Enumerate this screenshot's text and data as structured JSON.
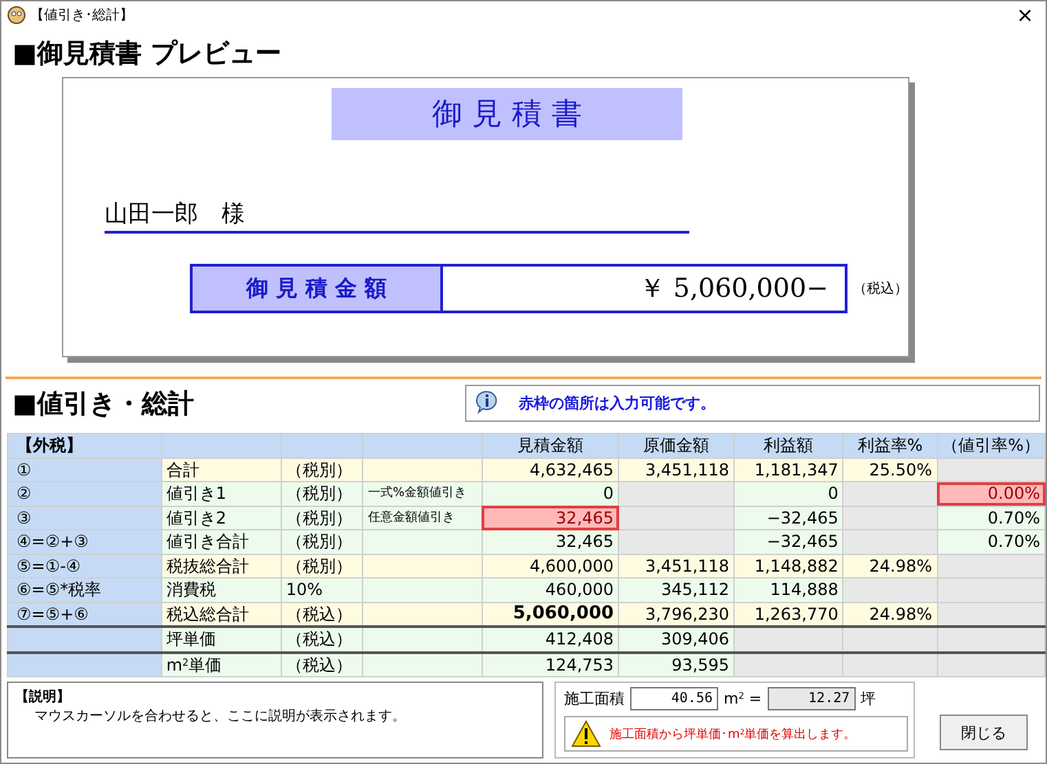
{
  "window": {
    "title": "【値引き･総計】",
    "close": "×"
  },
  "preview": {
    "heading": "■御見積書 プレビュー",
    "doc_title": "御 見 積 書",
    "customer": "山田一郎　様",
    "amount_label": "御 見 積 金 額",
    "amount": "￥ 5,060,000−",
    "tax_note": "（税込）"
  },
  "summary": {
    "heading": "■値引き・総計",
    "info": "赤枠の箇所は入力可能です。"
  },
  "table": {
    "header": [
      {
        "kind": "text",
        "text": "【外税】"
      },
      {
        "kind": "empty"
      },
      {
        "kind": "empty"
      },
      {
        "kind": "empty"
      },
      {
        "kind": "text",
        "text": "見積金額"
      },
      {
        "kind": "text",
        "text": "原価金額"
      },
      {
        "kind": "text",
        "text": "利益額"
      },
      {
        "kind": "text",
        "text": "利益率%"
      },
      {
        "kind": "text",
        "text": "（値引率%）"
      }
    ],
    "rows": [
      {
        "color": "#fffbe1",
        "divider_above": false,
        "cells": [
          {
            "kind": "text",
            "text": "①"
          },
          {
            "kind": "text",
            "text": "合計"
          },
          {
            "kind": "text",
            "text": "（税別）"
          },
          {
            "kind": "empty"
          },
          {
            "kind": "text",
            "text": "4,632,465"
          },
          {
            "kind": "text",
            "text": "3,451,118"
          },
          {
            "kind": "text",
            "text": "1,181,347"
          },
          {
            "kind": "text",
            "text": "25.50%"
          },
          {
            "kind": "gray"
          }
        ]
      },
      {
        "color": "#edfbec",
        "divider_above": false,
        "cells": [
          {
            "kind": "text",
            "text": "②"
          },
          {
            "kind": "text",
            "text": "値引き1"
          },
          {
            "kind": "text",
            "text": "（税別）"
          },
          {
            "kind": "note",
            "text": "一式%金額値引き"
          },
          {
            "kind": "text",
            "text": "0"
          },
          {
            "kind": "gray"
          },
          {
            "kind": "text",
            "text": "0"
          },
          {
            "kind": "gray"
          },
          {
            "kind": "input",
            "text": "0.00%"
          }
        ]
      },
      {
        "color": "#edfbec",
        "divider_above": false,
        "cells": [
          {
            "kind": "text",
            "text": "③"
          },
          {
            "kind": "text",
            "text": "値引き2"
          },
          {
            "kind": "text",
            "text": "（税別）"
          },
          {
            "kind": "note",
            "text": "任意金額値引き"
          },
          {
            "kind": "input",
            "text": "32,465"
          },
          {
            "kind": "gray"
          },
          {
            "kind": "text",
            "text": "−32,465"
          },
          {
            "kind": "gray"
          },
          {
            "kind": "text",
            "text": "0.70%"
          }
        ]
      },
      {
        "color": "#edfbec",
        "divider_above": false,
        "cells": [
          {
            "kind": "text",
            "text": "④=②+③"
          },
          {
            "kind": "text",
            "text": "値引き合計"
          },
          {
            "kind": "text",
            "text": "（税別）"
          },
          {
            "kind": "empty"
          },
          {
            "kind": "text",
            "text": "32,465"
          },
          {
            "kind": "gray"
          },
          {
            "kind": "text",
            "text": "−32,465"
          },
          {
            "kind": "gray"
          },
          {
            "kind": "text",
            "text": "0.70%"
          }
        ]
      },
      {
        "color": "#fffbe1",
        "divider_above": false,
        "cells": [
          {
            "kind": "text",
            "text": "⑤=①-④"
          },
          {
            "kind": "text",
            "text": "税抜総合計"
          },
          {
            "kind": "text",
            "text": "（税別）"
          },
          {
            "kind": "empty"
          },
          {
            "kind": "text",
            "text": "4,600,000"
          },
          {
            "kind": "text",
            "text": "3,451,118"
          },
          {
            "kind": "text",
            "text": "1,148,882"
          },
          {
            "kind": "text",
            "text": "24.98%"
          },
          {
            "kind": "gray"
          }
        ]
      },
      {
        "color": "#edfbec",
        "divider_above": false,
        "cells": [
          {
            "kind": "text",
            "text": "⑥=⑤*税率"
          },
          {
            "kind": "text",
            "text": "消費税"
          },
          {
            "kind": "text",
            "text": "10%"
          },
          {
            "kind": "empty"
          },
          {
            "kind": "text",
            "text": "460,000"
          },
          {
            "kind": "text",
            "text": "345,112"
          },
          {
            "kind": "text",
            "text": "114,888"
          },
          {
            "kind": "gray"
          },
          {
            "kind": "gray"
          }
        ]
      },
      {
        "color": "#fffbe1",
        "divider_above": false,
        "cells": [
          {
            "kind": "text",
            "text": "⑦=⑤+⑥"
          },
          {
            "kind": "text",
            "text": "税込総合計"
          },
          {
            "kind": "text",
            "text": "（税込）"
          },
          {
            "kind": "empty"
          },
          {
            "kind": "strong",
            "text": "5,060,000"
          },
          {
            "kind": "text",
            "text": "3,796,230"
          },
          {
            "kind": "text",
            "text": "1,263,770"
          },
          {
            "kind": "text",
            "text": "24.98%"
          },
          {
            "kind": "gray"
          }
        ]
      },
      {
        "color": "#edfbec",
        "divider_above": true,
        "cells": [
          {
            "kind": "empty"
          },
          {
            "kind": "text",
            "text": "坪単価"
          },
          {
            "kind": "text",
            "text": "（税込）"
          },
          {
            "kind": "empty"
          },
          {
            "kind": "text",
            "text": "412,408"
          },
          {
            "kind": "text",
            "text": "309,406"
          },
          {
            "kind": "gray"
          },
          {
            "kind": "gray"
          },
          {
            "kind": "gray"
          }
        ]
      },
      {
        "color": "#edfbec",
        "divider_above": true,
        "cells": [
          {
            "kind": "empty"
          },
          {
            "kind": "text",
            "text": "m$^{2}$単価"
          },
          {
            "kind": "text",
            "text": "（税込）"
          },
          {
            "kind": "empty"
          },
          {
            "kind": "text",
            "text": "124,753"
          },
          {
            "kind": "text",
            "text": "93,595"
          },
          {
            "kind": "gray"
          },
          {
            "kind": "gray"
          },
          {
            "kind": "gray"
          }
        ]
      }
    ]
  },
  "description": {
    "title": "【説明】",
    "text": "マウスカーソルを合わせると、ここに説明が表示されます。"
  },
  "area": {
    "label": "施工面積",
    "value": "40.56",
    "unit": "m$^{2}$ =",
    "tsubo": "12.27",
    "tsubo_unit": "坪",
    "warning": "施工面積から坪単価･m$^{2}$単価を算出します。"
  },
  "buttons": [
    "閉じる"
  ]
}
